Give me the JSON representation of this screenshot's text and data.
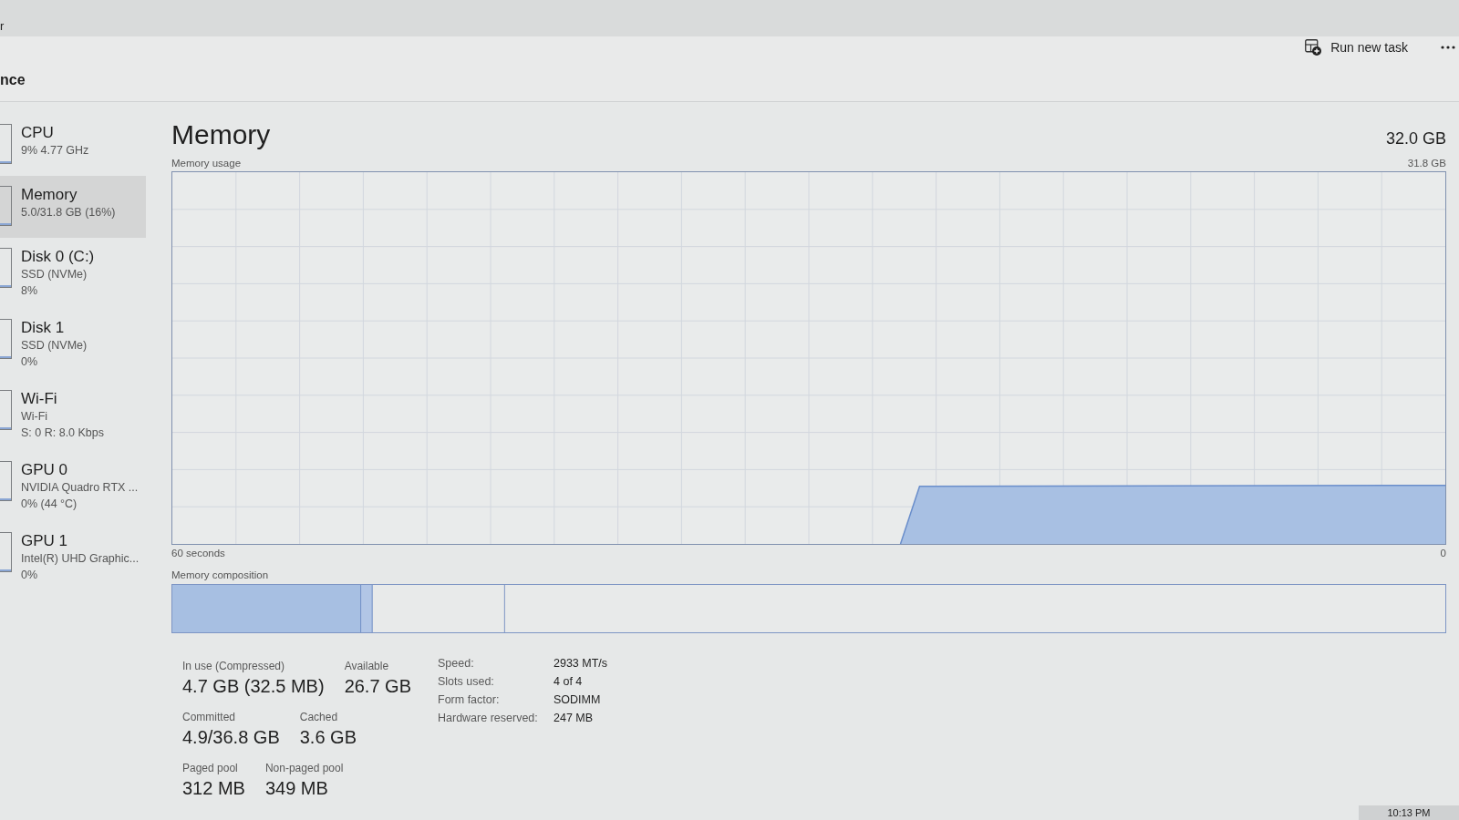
{
  "window": {
    "title": "r"
  },
  "page": {
    "title": "nce"
  },
  "toolbar": {
    "buttons": [
      {
        "kind": "run",
        "label": "Run new task"
      },
      {
        "kind": "more"
      }
    ]
  },
  "sidebar": {
    "items": [
      {
        "title": "CPU",
        "lines": [
          "9% 4.77 GHz"
        ],
        "selected": false
      },
      {
        "title": "Memory",
        "lines": [
          "5.0/31.8 GB (16%)"
        ],
        "selected": true
      },
      {
        "title": "Disk 0 (C:)",
        "lines": [
          "SSD (NVMe)",
          "8%"
        ],
        "selected": false
      },
      {
        "title": "Disk 1",
        "lines": [
          "SSD (NVMe)",
          "0%"
        ],
        "selected": false
      },
      {
        "title": "Wi-Fi",
        "lines": [
          "Wi-Fi",
          "S: 0 R: 8.0 Kbps"
        ],
        "selected": false
      },
      {
        "title": "GPU 0",
        "lines": [
          "NVIDIA Quadro RTX ...",
          "0% (44 °C)"
        ],
        "selected": false
      },
      {
        "title": "GPU 1",
        "lines": [
          "Intel(R) UHD Graphic...",
          "0%"
        ],
        "selected": false
      }
    ]
  },
  "detail": {
    "title": "Memory",
    "capacity": "32.0 GB",
    "usage_graph": {
      "label": "Memory usage",
      "max_label": "31.8 GB",
      "time_label": "60 seconds",
      "end_label": "0"
    },
    "composition": {
      "label": "Memory composition"
    },
    "stats": [
      [
        {
          "label": "In use (Compressed)",
          "value": "4.7 GB (32.5 MB)"
        },
        {
          "label": "Available",
          "value": "26.7 GB"
        }
      ],
      [
        {
          "label": "Committed",
          "value": "4.9/36.8 GB"
        },
        {
          "label": "Cached",
          "value": "3.6 GB"
        }
      ],
      [
        {
          "label": "Paged pool",
          "value": "312 MB"
        },
        {
          "label": "Non-paged pool",
          "value": "349 MB"
        }
      ]
    ],
    "properties": [
      {
        "label": "Speed:",
        "value": "2933 MT/s"
      },
      {
        "label": "Slots used:",
        "value": "4 of 4"
      },
      {
        "label": "Form factor:",
        "value": "SODIMM"
      },
      {
        "label": "Hardware reserved:",
        "value": "247 MB"
      }
    ]
  },
  "taskbar": {
    "clock": "10:13 PM"
  }
}
